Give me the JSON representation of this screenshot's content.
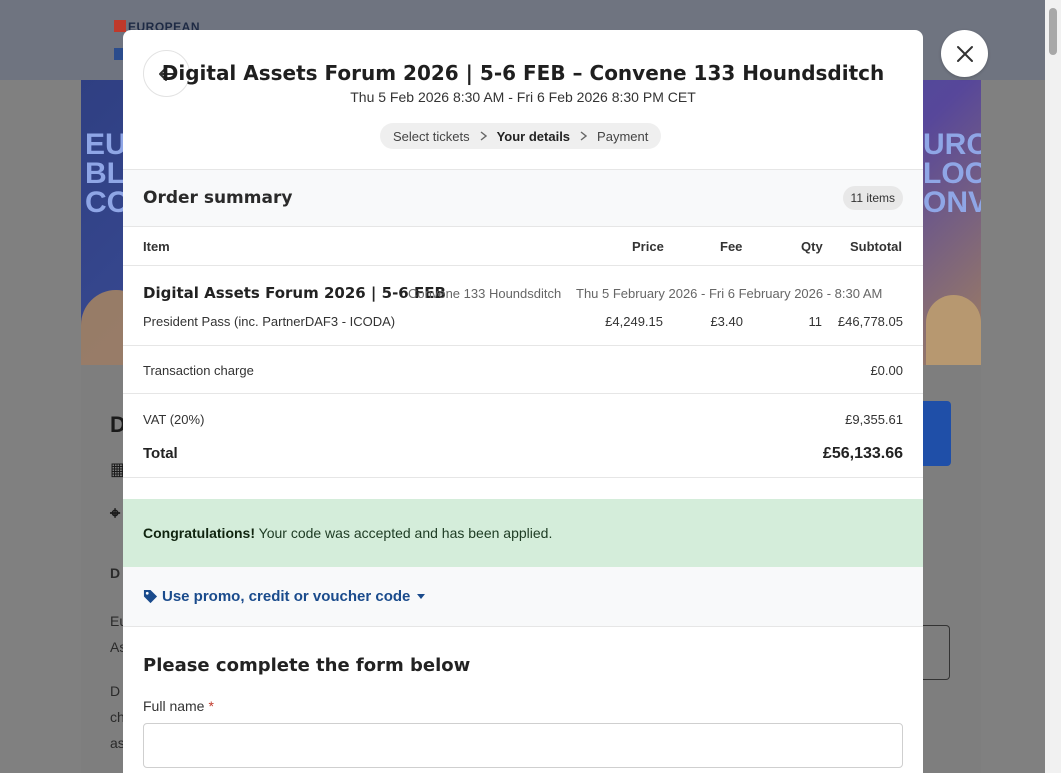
{
  "background": {
    "logo_text": "EUROPEAN",
    "hero_left_text": [
      "EU",
      "BL",
      "CO"
    ],
    "hero_right_text": [
      "URO",
      "LOC",
      "ONV"
    ],
    "left_glyphs": [
      "D",
      "▦",
      "⌖"
    ],
    "left_text": [
      "D",
      "Eu",
      "As",
      "",
      "D",
      "ch",
      "as"
    ]
  },
  "modal": {
    "title": "Digital Assets Forum 2026 | 5-6 FEB – Convene 133 Houndsditch",
    "datetime": "Thu 5 Feb 2026 8:30 AM - Fri 6 Feb 2026 8:30 PM CET",
    "steps": [
      {
        "label": "Select tickets"
      },
      {
        "label": "Your details"
      },
      {
        "label": "Payment"
      }
    ]
  },
  "order": {
    "title": "Order summary",
    "items_badge": "11 items",
    "columns": {
      "item": "Item",
      "price": "Price",
      "fee": "Fee",
      "qty": "Qty",
      "subtotal": "Subtotal"
    },
    "event_name": "Digital Assets Forum 2026 | 5-6 FEB",
    "venue": "Convene 133 Houndsditch",
    "dates": "Thu 5 February 2026 - Fri 6 February 2026 - 8:30 AM",
    "ticket": {
      "name": "President Pass (inc. PartnerDAF3 - ICODA)",
      "price": "£4,249.15",
      "fee": "£3.40",
      "qty": "11",
      "subtotal": "£46,778.05"
    },
    "transaction_charge_label": "Transaction charge",
    "transaction_charge_value": "£0.00",
    "vat_label": "VAT (20%)",
    "vat_value": "£9,355.61",
    "total_label": "Total",
    "total_value": "£56,133.66"
  },
  "success": {
    "strong": "Congratulations!",
    "message": " Your code was accepted and has been applied."
  },
  "promo": {
    "label": "Use promo, credit or voucher code"
  },
  "form": {
    "title": "Please complete the form below",
    "full_name_label": "Full name",
    "required_mark": "*",
    "full_name_value": ""
  },
  "icons": {
    "close": "close-icon",
    "back": "arrow-left-icon",
    "step_separator": "chevron-right-icon",
    "promo": "tag-icon",
    "promo_toggle": "caret-down-icon"
  },
  "colors": {
    "success_bg": "#d4edda",
    "link": "#1a4b8c",
    "required": "#c0392b"
  }
}
